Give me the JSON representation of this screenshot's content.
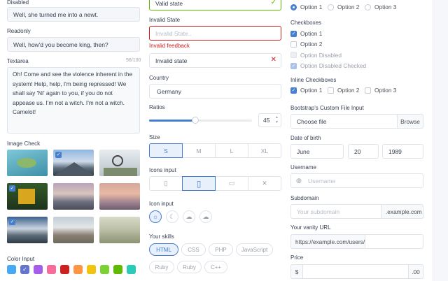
{
  "col1": {
    "disabled": {
      "label": "Disabled",
      "value": "Well, she turned me into a newt."
    },
    "readonly": {
      "label": "Readonly",
      "value": "Well, how'd you become king, then?"
    },
    "textarea": {
      "label": "Textarea",
      "counter": "56/100",
      "value": "Oh! Come and see the violence inherent in the system! Help, help, I'm being repressed! We shall say 'Ni' again to you, if you do not appease us. I'm not a witch. I'm not a witch. Camelot!"
    },
    "image_check": {
      "label": "Image Check",
      "checked": [
        false,
        true,
        false,
        true,
        false,
        false,
        true,
        false,
        false
      ]
    },
    "color_input": {
      "label": "Color Input",
      "colors": [
        "#45aaf2",
        "#6574cd",
        "#a55eea",
        "#f66d9b",
        "#cd201f",
        "#fd9644",
        "#f1c40f",
        "#7bd235",
        "#5eba00",
        "#2bcbba"
      ],
      "selected_index": 1
    }
  },
  "col2": {
    "valid": {
      "value": "Valid state"
    },
    "invalid": {
      "label": "Invalid State",
      "placeholder": "Invalid State..",
      "feedback": "Invalid feedback"
    },
    "invalid2": {
      "value": "Invalid state"
    },
    "country": {
      "label": "Country",
      "value": "Germany"
    },
    "ratios": {
      "label": "Ratios",
      "value": "45",
      "level": 0.45
    },
    "size": {
      "label": "Size",
      "options": [
        "S",
        "M",
        "L",
        "XL"
      ],
      "selected_index": 0
    },
    "icons_input": {
      "label": "Icons input",
      "options": [
        "mobile-icon",
        "tablet-icon",
        "monitor-icon",
        "x-icon"
      ],
      "selected_index": 1
    },
    "icon_input": {
      "label": "Icon input",
      "options": [
        "sun-icon",
        "moon-icon",
        "cloud-rain-icon",
        "cloud-icon"
      ],
      "selected_index": 0
    },
    "skills": {
      "label": "Your skills",
      "row1": [
        "HTML",
        "CSS",
        "PHP",
        "JavaScript"
      ],
      "row2": [
        "Ruby",
        "Ruby",
        "C++"
      ],
      "selected": "HTML"
    }
  },
  "col3": {
    "radios": {
      "options": [
        "Option 1",
        "Option 2",
        "Option 3"
      ],
      "selected_index": 0
    },
    "checkboxes": {
      "label": "Checkboxes",
      "items": [
        "Option 1",
        "Option 2",
        "Option Disabled",
        "Option Disabled Checked"
      ]
    },
    "inline_checkboxes": {
      "label": "Inline Checkboxes",
      "items": [
        "Option 1",
        "Option 2",
        "Option 3"
      ]
    },
    "file": {
      "label": "Bootstrap's Custom File Input",
      "placeholder": "Choose file",
      "button": "Browse"
    },
    "dob": {
      "label": "Date of birth",
      "month": "June",
      "day": "20",
      "year": "1989"
    },
    "username": {
      "label": "Username",
      "placeholder": "Username"
    },
    "subdomain": {
      "label": "Subdomain",
      "placeholder": "Your subdomain",
      "suffix": ".example.com"
    },
    "vanity": {
      "label": "Your vanity URL",
      "prefix": "https://example.com/users/"
    },
    "price": {
      "label": "Price",
      "prefix": "$",
      "suffix": ".00"
    }
  },
  "colors": {
    "accent": "#467fcf",
    "valid": "#5eba00",
    "invalid": "#cd201f"
  }
}
